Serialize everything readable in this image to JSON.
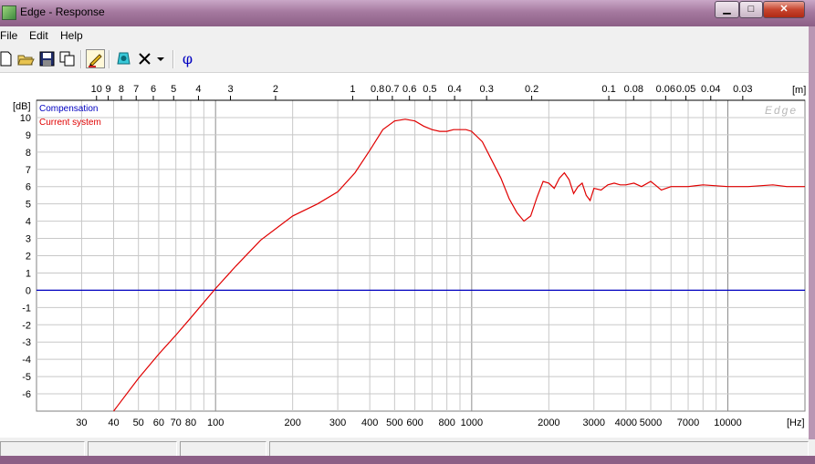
{
  "window": {
    "title": "Edge - Response",
    "minimize_label": "▁",
    "maximize_label": "□",
    "close_label": "✕"
  },
  "menu": [
    {
      "label": "File"
    },
    {
      "label": "Edit"
    },
    {
      "label": "Help"
    }
  ],
  "toolbar": {
    "buttons": [
      {
        "icon": "new-file-icon"
      },
      {
        "icon": "open-folder-icon"
      },
      {
        "icon": "save-icon"
      },
      {
        "icon": "copy-icon"
      },
      {
        "icon": "pencil-icon",
        "pressed": true
      },
      {
        "icon": "speaker-icon"
      },
      {
        "icon": "delete-icon"
      },
      {
        "icon": "dropdown-arrow-icon"
      },
      {
        "icon": "phase-icon",
        "label": "φ"
      }
    ]
  },
  "chart_data": {
    "type": "line",
    "watermark": "Edge",
    "xlabel": "[Hz]",
    "ylabel": "[dB]",
    "x_scale": "log",
    "xlim": [
      20,
      20000
    ],
    "ylim": [
      -7,
      11
    ],
    "grid": true,
    "x_ticks": [
      "30",
      "40",
      "50",
      "60",
      "70",
      "80",
      "100",
      "200",
      "300",
      "400",
      "500",
      "600",
      "800",
      "1000",
      "2000",
      "3000",
      "4000",
      "5000",
      "7000",
      "10000"
    ],
    "x_tick_values": [
      30,
      40,
      50,
      60,
      70,
      80,
      100,
      200,
      300,
      400,
      500,
      600,
      800,
      1000,
      2000,
      3000,
      4000,
      5000,
      7000,
      10000
    ],
    "y_ticks": [
      "10",
      "9",
      "8",
      "7",
      "6",
      "5",
      "4",
      "3",
      "2",
      "1",
      "0",
      "-1",
      "-2",
      "-3",
      "-4",
      "-5",
      "-6"
    ],
    "y_tick_values": [
      10,
      9,
      8,
      7,
      6,
      5,
      4,
      3,
      2,
      1,
      0,
      -1,
      -2,
      -3,
      -4,
      -5,
      -6
    ],
    "top_axis": {
      "label": "[m]",
      "ticks": [
        "10",
        "9",
        "8",
        "7",
        "6",
        "5",
        "4",
        "3",
        "2",
        "1",
        "0.8",
        "0.7",
        "0.6",
        "0.5",
        "0.4",
        "0.3",
        "0.2",
        "0.1",
        "0.08",
        "0.06",
        "0.05",
        "0.04",
        "0.03"
      ],
      "tick_values": [
        10,
        9,
        8,
        7,
        6,
        5,
        4,
        3,
        2,
        1,
        0.8,
        0.7,
        0.6,
        0.5,
        0.4,
        0.3,
        0.2,
        0.1,
        0.08,
        0.06,
        0.05,
        0.04,
        0.03
      ]
    },
    "legend": "top-left",
    "series": [
      {
        "name": "Compensation",
        "color": "#0000c0",
        "x": [
          20,
          20000
        ],
        "y": [
          0,
          0
        ]
      },
      {
        "name": "Current system",
        "color": "#e00000",
        "x": [
          40,
          50,
          60,
          70,
          80,
          100,
          120,
          150,
          200,
          250,
          300,
          350,
          400,
          450,
          500,
          550,
          600,
          650,
          700,
          750,
          800,
          850,
          900,
          950,
          1000,
          1100,
          1200,
          1300,
          1400,
          1500,
          1600,
          1700,
          1800,
          1900,
          2000,
          2100,
          2200,
          2300,
          2400,
          2500,
          2600,
          2700,
          2800,
          2900,
          3000,
          3200,
          3400,
          3600,
          3800,
          4000,
          4300,
          4600,
          5000,
          5200,
          5500,
          6000,
          7000,
          8000,
          10000,
          12000,
          15000,
          17000,
          20000
        ],
        "y": [
          -7,
          -5.1,
          -3.7,
          -2.6,
          -1.6,
          0.1,
          1.4,
          2.9,
          4.3,
          5.0,
          5.7,
          6.8,
          8.1,
          9.3,
          9.8,
          9.9,
          9.8,
          9.5,
          9.3,
          9.2,
          9.2,
          9.3,
          9.3,
          9.3,
          9.2,
          8.6,
          7.5,
          6.5,
          5.3,
          4.5,
          4.0,
          4.3,
          5.4,
          6.3,
          6.2,
          5.9,
          6.5,
          6.8,
          6.4,
          5.6,
          6.0,
          6.2,
          5.5,
          5.2,
          5.9,
          5.8,
          6.1,
          6.2,
          6.1,
          6.1,
          6.2,
          6.0,
          6.3,
          6.1,
          5.8,
          6.0,
          6.0,
          6.1,
          6.0,
          6.0,
          6.1,
          6.0,
          6.0
        ]
      }
    ]
  },
  "statusbar": {
    "panels": [
      "",
      "",
      "",
      ""
    ]
  }
}
